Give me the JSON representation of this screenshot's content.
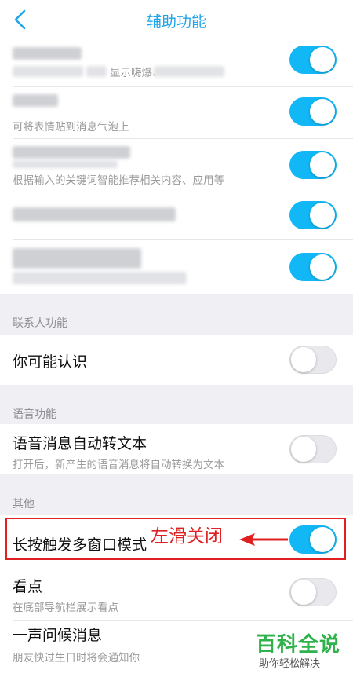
{
  "header": {
    "title": "辅助功能",
    "back_icon": "chevron-left-icon"
  },
  "colors": {
    "accent": "#1fa4e8",
    "toggle_on": "#12b7f5",
    "annotation": "#e02020",
    "watermark": "#2fb14b"
  },
  "top_settings": [
    {
      "label": "",
      "sub_label": "显示嗨爆、",
      "enabled": true
    },
    {
      "label": "",
      "sub_label": "可将表情贴到消息气泡上",
      "enabled": true
    },
    {
      "label": "",
      "sub_label": "根据输入的关键词智能推荐相关内容、应用等",
      "enabled": true
    },
    {
      "label": "",
      "sub_label": "",
      "enabled": true
    },
    {
      "label": "",
      "sub_label": "",
      "enabled": true
    }
  ],
  "contacts": {
    "section_title": "联系人功能",
    "items": [
      {
        "label": "你可能认识",
        "enabled": false
      }
    ]
  },
  "voice": {
    "section_title": "语音功能",
    "items": [
      {
        "label": "语音消息自动转文本",
        "sub_label": "打开后，新产生的语音消息将自动转换为文本",
        "enabled": false
      }
    ]
  },
  "other": {
    "section_title": "其他",
    "items": [
      {
        "label": "长按触发多窗口模式",
        "enabled": true
      },
      {
        "label": "看点",
        "sub_label": "在底部导航栏展示看点",
        "enabled": false
      },
      {
        "label": "一声问候消息",
        "sub_label": "朋友快过生日时将会通知你",
        "enabled": false
      }
    ]
  },
  "annotation": {
    "text": "左滑关闭"
  },
  "watermark": {
    "title": "百科全说",
    "subtitle": "助你轻松解决"
  }
}
